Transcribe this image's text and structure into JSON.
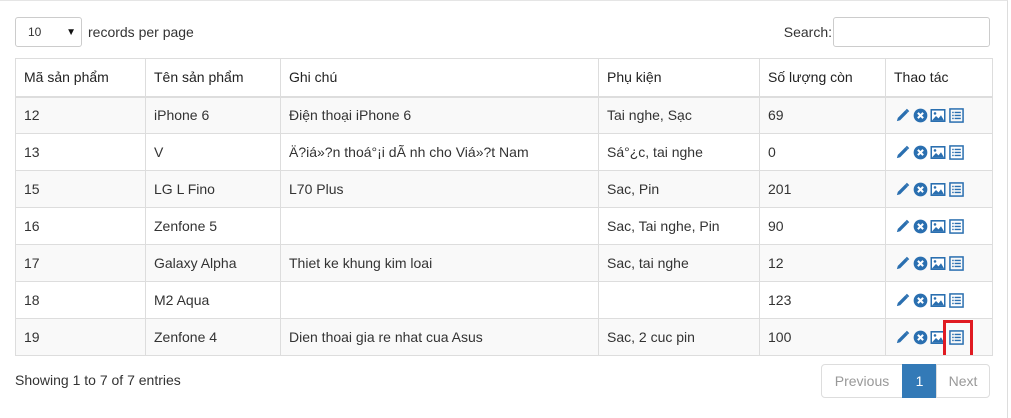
{
  "length_menu": {
    "selected": "10",
    "label": "records per page"
  },
  "search": {
    "label": "Search:",
    "value": ""
  },
  "table": {
    "columns": [
      "Mã sản phẩm",
      "Tên sản phẩm",
      "Ghi chú",
      "Phụ kiện",
      "Số lượng còn",
      "Thao tác"
    ],
    "rows": [
      [
        "12",
        "iPhone 6",
        "Điện thoại iPhone 6",
        "Tai nghe, Sạc",
        "69"
      ],
      [
        "13",
        "V",
        "Ä?iá»?n thoá°¡i dÃ nh cho Viá»?t Nam",
        "Sá°¿c, tai nghe",
        "0"
      ],
      [
        "15",
        "LG L Fino",
        "L70 Plus",
        "Sac, Pin",
        "201"
      ],
      [
        "16",
        "Zenfone 5",
        "",
        "Sac, Tai nghe, Pin",
        "90"
      ],
      [
        "17",
        "Galaxy Alpha",
        "Thiet ke khung kim loai",
        "Sac, tai nghe",
        "12"
      ],
      [
        "18",
        "M2 Aqua",
        "",
        "",
        "123"
      ],
      [
        "19",
        "Zenfone 4",
        "Dien thoai gia re nhat cua Asus",
        "Sac, 2 cuc pin",
        "100"
      ]
    ],
    "action_icons": [
      "pencil-icon",
      "remove-circle-icon",
      "picture-icon",
      "list-alt-icon"
    ],
    "highlight": {
      "row": 6,
      "icon": "list-alt-icon",
      "color": "#e01b22"
    }
  },
  "info": "Showing 1 to 7 of 7 entries",
  "pagination": {
    "previous": "Previous",
    "current": "1",
    "next": "Next"
  },
  "colors": {
    "accent": "#337ab7",
    "icon": "#2a6fb0",
    "stripe": "#f9f9f9",
    "border": "#dddddd"
  }
}
